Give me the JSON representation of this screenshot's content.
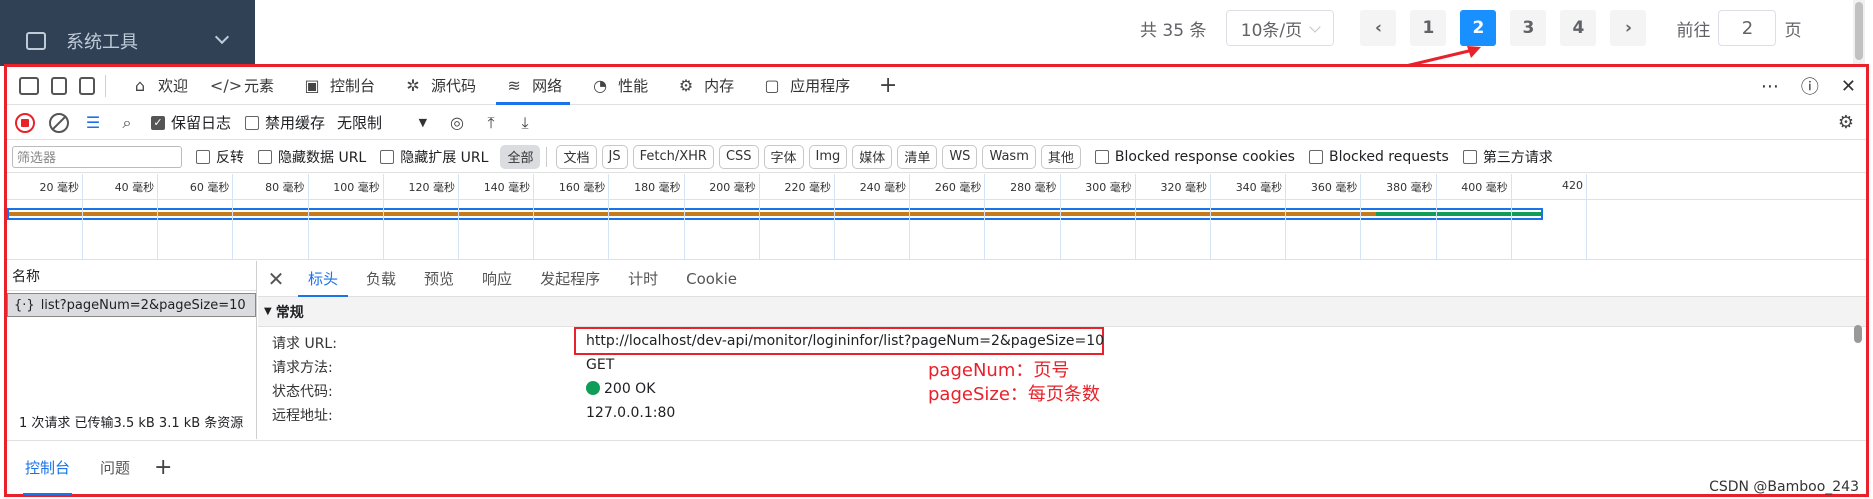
{
  "sidebar": {
    "menu_label": "系统工具"
  },
  "pagination": {
    "total_label": "共 35 条",
    "page_size": "10条/页",
    "pages": [
      "1",
      "2",
      "3",
      "4"
    ],
    "current_page": "2",
    "goto_prefix": "前往",
    "goto_value": "2",
    "goto_suffix": "页"
  },
  "devtools": {
    "tabs": [
      {
        "label": "欢迎",
        "icon": "home-icon"
      },
      {
        "label": "元素",
        "icon": "code-icon"
      },
      {
        "label": "控制台",
        "icon": "console-icon"
      },
      {
        "label": "源代码",
        "icon": "bug-icon"
      },
      {
        "label": "网络",
        "icon": "wifi-icon"
      },
      {
        "label": "性能",
        "icon": "gauge-icon"
      },
      {
        "label": "内存",
        "icon": "gear-icon"
      },
      {
        "label": "应用程序",
        "icon": "app-icon"
      }
    ],
    "active_tab": "网络",
    "toolbar": {
      "preserve_log": "保留日志",
      "disable_cache": "禁用缓存",
      "throttling": "无限制"
    },
    "filter": {
      "placeholder": "筛选器",
      "invert": "反转",
      "hide_data_url": "隐藏数据 URL",
      "hide_ext_url": "隐藏扩展 URL",
      "types": [
        "全部",
        "文档",
        "JS",
        "Fetch/XHR",
        "CSS",
        "字体",
        "Img",
        "媒体",
        "清单",
        "WS",
        "Wasm",
        "其他"
      ],
      "blocked_cookies": "Blocked response cookies",
      "blocked_requests": "Blocked requests",
      "third_party": "第三方请求"
    },
    "timeline_ticks": [
      "20 毫秒",
      "40 毫秒",
      "60 毫秒",
      "80 毫秒",
      "100 毫秒",
      "120 毫秒",
      "140 毫秒",
      "160 毫秒",
      "180 毫秒",
      "200 毫秒",
      "220 毫秒",
      "240 毫秒",
      "260 毫秒",
      "280 毫秒",
      "300 毫秒",
      "320 毫秒",
      "340 毫秒",
      "360 毫秒",
      "380 毫秒",
      "400 毫秒",
      "420"
    ],
    "request_list": {
      "header": "名称",
      "item": "list?pageNum=2&pageSize=10",
      "summary": "1 次请求  已传输3.5 kB  3.1 kB 条资源"
    },
    "detail_tabs": [
      "标头",
      "负载",
      "预览",
      "响应",
      "发起程序",
      "计时",
      "Cookie"
    ],
    "general": {
      "section": "常规",
      "url_label": "请求 URL:",
      "url_value": "http://localhost/dev-api/monitor/logininfor/list?pageNum=2&pageSize=10",
      "method_label": "请求方法:",
      "method_value": "GET",
      "status_label": "状态代码:",
      "status_value": "200 OK",
      "remote_label": "远程地址:",
      "remote_value": "127.0.0.1:80"
    },
    "notes": [
      "pageNum：页号",
      "pageSize：每页条数"
    ],
    "drawer_tabs": [
      "控制台",
      "问题"
    ]
  },
  "watermark": "CSDN @Bamboo_243",
  "colors": {
    "accent": "#1a73e8",
    "annotation": "#e8212a",
    "pager_active": "#1890ff"
  }
}
